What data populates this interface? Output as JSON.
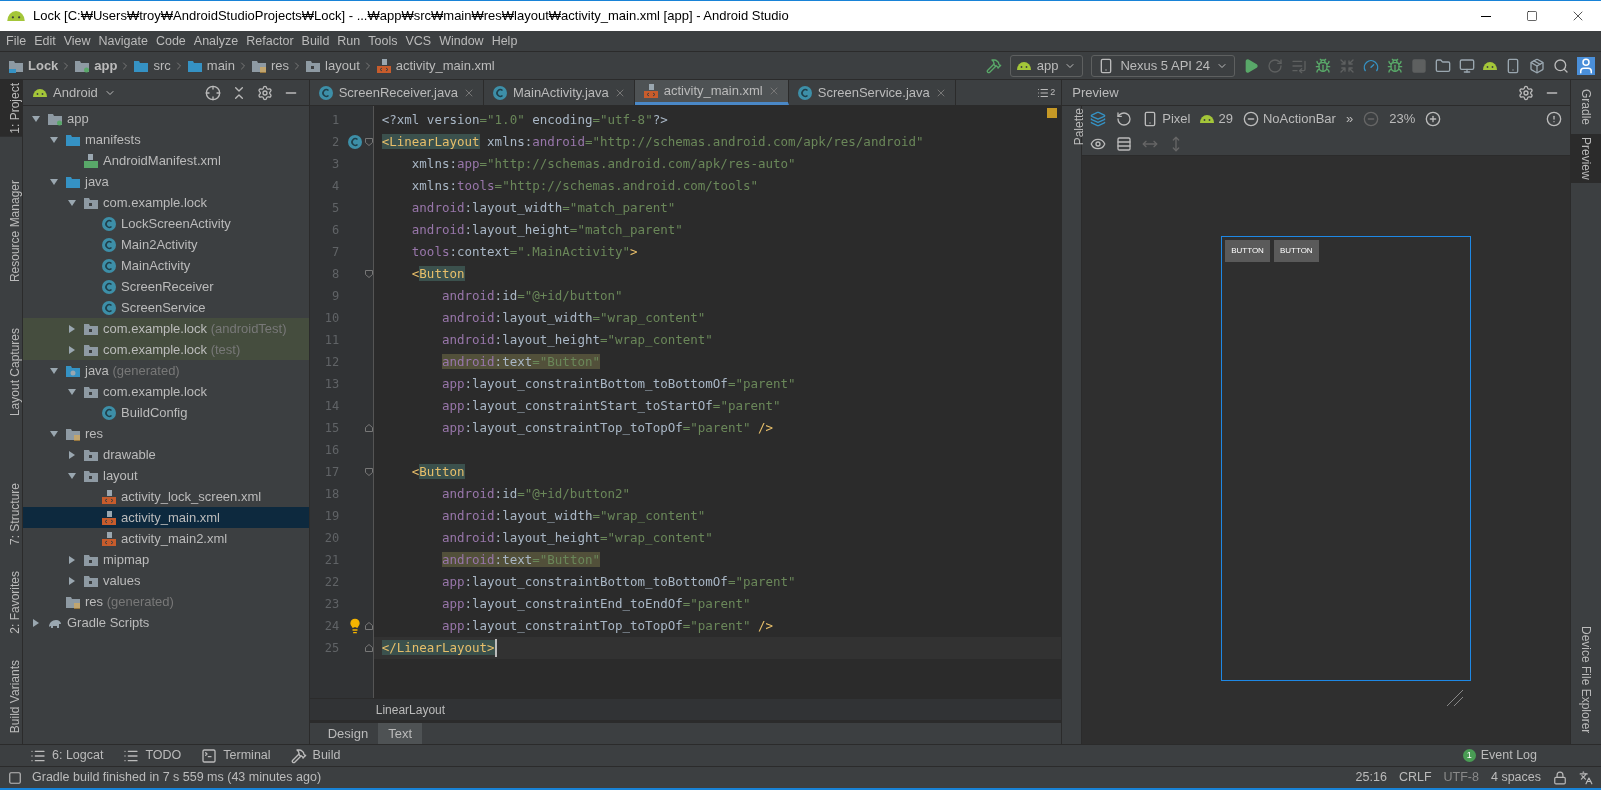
{
  "window": {
    "title": "Lock [C:₩Users₩troy₩AndroidStudioProjects₩Lock] - ...₩app₩src₩main₩res₩layout₩activity_main.xml [app] - Android Studio"
  },
  "menu": [
    "File",
    "Edit",
    "View",
    "Navigate",
    "Code",
    "Analyze",
    "Refactor",
    "Build",
    "Run",
    "Tools",
    "VCS",
    "Window",
    "Help"
  ],
  "breadcrumbs": [
    {
      "label": "Lock",
      "kind": "project"
    },
    {
      "label": "app",
      "kind": "module"
    },
    {
      "label": "src",
      "kind": "folder"
    },
    {
      "label": "main",
      "kind": "folder"
    },
    {
      "label": "res",
      "kind": "res"
    },
    {
      "label": "layout",
      "kind": "package"
    },
    {
      "label": "activity_main.xml",
      "kind": "xml"
    }
  ],
  "toolbar": {
    "run_config": "app",
    "device": "Nexus 5 API 24"
  },
  "left_stripe": [
    {
      "label": "1: Project",
      "selected": true
    },
    {
      "label": "Resource Manager",
      "selected": false
    },
    {
      "label": "Layout Captures",
      "selected": false
    },
    {
      "label": "7: Structure",
      "selected": false
    },
    {
      "label": "2: Favorites",
      "selected": false
    },
    {
      "label": "Build Variants",
      "selected": false
    }
  ],
  "right_stripe": [
    {
      "label": "Gradle",
      "selected": false
    },
    {
      "label": "Preview",
      "selected": true
    },
    {
      "label": "Device File Explorer",
      "selected": false
    }
  ],
  "project_panel": {
    "view": "Android",
    "tree": [
      {
        "label": "app",
        "kind": "module",
        "expanded": true,
        "selected": false,
        "highlighted": false,
        "children": [
          {
            "label": "manifests",
            "kind": "folder",
            "expanded": true,
            "selected": false,
            "highlighted": false,
            "children": [
              {
                "label": "AndroidManifest.xml",
                "kind": "manifest",
                "selected": false,
                "highlighted": false
              }
            ]
          },
          {
            "label": "java",
            "kind": "folder",
            "expanded": true,
            "selected": false,
            "highlighted": false,
            "children": [
              {
                "label": "com.example.lock",
                "kind": "package",
                "expanded": true,
                "selected": false,
                "highlighted": false,
                "children": [
                  {
                    "label": "LockScreenActivity",
                    "kind": "class",
                    "selected": false,
                    "highlighted": false
                  },
                  {
                    "label": "Main2Activity",
                    "kind": "class",
                    "selected": false,
                    "highlighted": false
                  },
                  {
                    "label": "MainActivity",
                    "kind": "class",
                    "selected": false,
                    "highlighted": false
                  },
                  {
                    "label": "ScreenReceiver",
                    "kind": "class",
                    "selected": false,
                    "highlighted": false
                  },
                  {
                    "label": "ScreenService",
                    "kind": "class",
                    "selected": false,
                    "highlighted": false
                  }
                ]
              },
              {
                "label": "com.example.lock",
                "note": "(androidTest)",
                "kind": "package",
                "expanded": false,
                "selected": false,
                "highlighted": true
              },
              {
                "label": "com.example.lock",
                "note": "(test)",
                "kind": "package",
                "expanded": false,
                "selected": false,
                "highlighted": true
              }
            ]
          },
          {
            "label": "java",
            "note": "(generated)",
            "kind": "generated",
            "expanded": true,
            "selected": false,
            "highlighted": false,
            "children": [
              {
                "label": "com.example.lock",
                "kind": "package",
                "expanded": true,
                "selected": false,
                "highlighted": false,
                "children": [
                  {
                    "label": "BuildConfig",
                    "kind": "class",
                    "selected": false,
                    "highlighted": false
                  }
                ]
              }
            ]
          },
          {
            "label": "res",
            "kind": "res",
            "expanded": true,
            "selected": false,
            "highlighted": false,
            "children": [
              {
                "label": "drawable",
                "kind": "package",
                "expanded": false,
                "selected": false,
                "highlighted": false
              },
              {
                "label": "layout",
                "kind": "package",
                "expanded": true,
                "selected": false,
                "highlighted": false,
                "children": [
                  {
                    "label": "activity_lock_screen.xml",
                    "kind": "xml",
                    "selected": false,
                    "highlighted": false
                  },
                  {
                    "label": "activity_main.xml",
                    "kind": "xml",
                    "selected": true,
                    "highlighted": false
                  },
                  {
                    "label": "activity_main2.xml",
                    "kind": "xml",
                    "selected": false,
                    "highlighted": false
                  }
                ]
              },
              {
                "label": "mipmap",
                "kind": "package",
                "expanded": false,
                "selected": false,
                "highlighted": false
              },
              {
                "label": "values",
                "kind": "package",
                "expanded": false,
                "selected": false,
                "highlighted": false
              }
            ]
          },
          {
            "label": "res",
            "note": "(generated)",
            "kind": "res",
            "selected": false,
            "highlighted": false
          }
        ]
      },
      {
        "label": "Gradle Scripts",
        "kind": "gradle",
        "expanded": false,
        "selected": false,
        "highlighted": false
      }
    ]
  },
  "editor": {
    "tabs": [
      {
        "label": "ScreenReceiver.java",
        "kind": "class",
        "selected": false
      },
      {
        "label": "MainActivity.java",
        "kind": "class",
        "selected": false
      },
      {
        "label": "activity_main.xml",
        "kind": "xml",
        "selected": true
      },
      {
        "label": "ScreenService.java",
        "kind": "class",
        "selected": false
      }
    ],
    "hidden_tabs": "2",
    "lines": [
      {
        "number": "1",
        "current": false,
        "tokens": [
          {
            "kind": "plain",
            "text": "<?xml version"
          },
          {
            "kind": "str",
            "text": "=\"1.0\""
          },
          {
            "kind": "plain",
            "text": " encoding"
          },
          {
            "kind": "str",
            "text": "=\"utf-8\""
          },
          {
            "kind": "plain",
            "text": "?>"
          }
        ]
      },
      {
        "number": "2",
        "current": false,
        "class_marker": true,
        "fold_start": true,
        "tokens": [
          {
            "kind": "tag",
            "text": "<LinearLayout",
            "marked": true
          },
          {
            "kind": "plain",
            "text": " xmlns:"
          },
          {
            "kind": "ns",
            "text": "android"
          },
          {
            "kind": "str",
            "text": "=\"http://schemas.android.com/apk/res/android\""
          }
        ]
      },
      {
        "number": "3",
        "current": false,
        "tokens": [
          {
            "kind": "plain",
            "text": "    xmlns:"
          },
          {
            "kind": "ns",
            "text": "app"
          },
          {
            "kind": "str",
            "text": "=\"http://schemas.android.com/apk/res-auto\""
          }
        ]
      },
      {
        "number": "4",
        "current": false,
        "tokens": [
          {
            "kind": "plain",
            "text": "    xmlns:"
          },
          {
            "kind": "ns",
            "text": "tools"
          },
          {
            "kind": "str",
            "text": "=\"http://schemas.android.com/tools\""
          }
        ]
      },
      {
        "number": "5",
        "current": false,
        "tokens": [
          {
            "kind": "ns",
            "text": "    android"
          },
          {
            "kind": "plain",
            "text": ":layout_width"
          },
          {
            "kind": "str",
            "text": "=\"match_parent\""
          }
        ]
      },
      {
        "number": "6",
        "current": false,
        "tokens": [
          {
            "kind": "ns",
            "text": "    android"
          },
          {
            "kind": "plain",
            "text": ":layout_height"
          },
          {
            "kind": "str",
            "text": "=\"match_parent\""
          }
        ]
      },
      {
        "number": "7",
        "current": false,
        "tokens": [
          {
            "kind": "ns",
            "text": "    tools"
          },
          {
            "kind": "plain",
            "text": ":context"
          },
          {
            "kind": "str",
            "text": "=\".MainActivity\""
          },
          {
            "kind": "tag",
            "text": ">"
          }
        ]
      },
      {
        "number": "8",
        "current": false,
        "fold_start": true,
        "tokens": [
          {
            "kind": "tag",
            "text": "    <"
          },
          {
            "kind": "tag",
            "text": "Button",
            "marked": true
          }
        ]
      },
      {
        "number": "9",
        "current": false,
        "tokens": [
          {
            "kind": "ns",
            "text": "        android"
          },
          {
            "kind": "plain",
            "text": ":id"
          },
          {
            "kind": "str",
            "text": "=\"@+id/button\""
          }
        ]
      },
      {
        "number": "10",
        "current": false,
        "tokens": [
          {
            "kind": "ns",
            "text": "        android"
          },
          {
            "kind": "plain",
            "text": ":layout_width"
          },
          {
            "kind": "str",
            "text": "=\"wrap_content\""
          }
        ]
      },
      {
        "number": "11",
        "current": false,
        "tokens": [
          {
            "kind": "ns",
            "text": "        android"
          },
          {
            "kind": "plain",
            "text": ":layout_height"
          },
          {
            "kind": "str",
            "text": "=\"wrap_content\""
          }
        ]
      },
      {
        "number": "12",
        "current": false,
        "tokens": [
          {
            "kind": "ns",
            "text": "        android",
            "marked": true
          },
          {
            "kind": "plain",
            "text": ":text",
            "marked": true
          },
          {
            "kind": "str",
            "text": "=\"Button\"",
            "marked": true
          }
        ]
      },
      {
        "number": "13",
        "current": false,
        "tokens": [
          {
            "kind": "ns",
            "text": "        app"
          },
          {
            "kind": "plain",
            "text": ":layout_constraintBottom_toBottomOf"
          },
          {
            "kind": "str",
            "text": "=\"parent\""
          }
        ]
      },
      {
        "number": "14",
        "current": false,
        "tokens": [
          {
            "kind": "ns",
            "text": "        app"
          },
          {
            "kind": "plain",
            "text": ":layout_constraintStart_toStartOf"
          },
          {
            "kind": "str",
            "text": "=\"parent\""
          }
        ]
      },
      {
        "number": "15",
        "current": false,
        "fold_end": true,
        "tokens": [
          {
            "kind": "ns",
            "text": "        app"
          },
          {
            "kind": "plain",
            "text": ":layout_constraintTop_toTopOf"
          },
          {
            "kind": "str",
            "text": "=\"parent\""
          },
          {
            "kind": "tag",
            "text": " />"
          }
        ]
      },
      {
        "number": "16",
        "current": false
      },
      {
        "number": "17",
        "current": false,
        "fold_start": true,
        "tokens": [
          {
            "kind": "tag",
            "text": "    <"
          },
          {
            "kind": "tag",
            "text": "Button",
            "marked": true
          }
        ]
      },
      {
        "number": "18",
        "current": false,
        "tokens": [
          {
            "kind": "ns",
            "text": "        android"
          },
          {
            "kind": "plain",
            "text": ":id"
          },
          {
            "kind": "str",
            "text": "=\"@+id/button2\""
          }
        ]
      },
      {
        "number": "19",
        "current": false,
        "tokens": [
          {
            "kind": "ns",
            "text": "        android"
          },
          {
            "kind": "plain",
            "text": ":layout_width"
          },
          {
            "kind": "str",
            "text": "=\"wrap_content\""
          }
        ]
      },
      {
        "number": "20",
        "current": false,
        "tokens": [
          {
            "kind": "ns",
            "text": "        android"
          },
          {
            "kind": "plain",
            "text": ":layout_height"
          },
          {
            "kind": "str",
            "text": "=\"wrap_content\""
          }
        ]
      },
      {
        "number": "21",
        "current": false,
        "tokens": [
          {
            "kind": "ns",
            "text": "        android",
            "marked": true
          },
          {
            "kind": "plain",
            "text": ":text",
            "marked": true
          },
          {
            "kind": "str",
            "text": "=\"Button\"",
            "marked": true
          }
        ]
      },
      {
        "number": "22",
        "current": false,
        "tokens": [
          {
            "kind": "ns",
            "text": "        app"
          },
          {
            "kind": "plain",
            "text": ":layout_constraintBottom_toBottomOf"
          },
          {
            "kind": "str",
            "text": "=\"parent\""
          }
        ]
      },
      {
        "number": "23",
        "current": false,
        "tokens": [
          {
            "kind": "ns",
            "text": "        app"
          },
          {
            "kind": "plain",
            "text": ":layout_constraintEnd_toEndOf"
          },
          {
            "kind": "str",
            "text": "=\"parent\""
          }
        ]
      },
      {
        "number": "24",
        "current": false,
        "intention_bulb": true,
        "fold_end": true,
        "tokens": [
          {
            "kind": "ns",
            "text": "        app"
          },
          {
            "kind": "plain",
            "text": ":layout_constraintTop_toTopOf"
          },
          {
            "kind": "str",
            "text": "=\"parent\""
          },
          {
            "kind": "tag",
            "text": " />"
          }
        ]
      },
      {
        "number": "25",
        "current": true,
        "fold_end": true,
        "tokens": [
          {
            "kind": "tag",
            "text": "</LinearLayout>",
            "marked": true
          }
        ]
      }
    ],
    "breadcrumb": "LinearLayout",
    "mode_tabs": [
      {
        "label": "Design",
        "selected": false
      },
      {
        "label": "Text",
        "selected": true
      }
    ]
  },
  "preview": {
    "title": "Preview",
    "palette": "Palette",
    "device": "Pixel",
    "api": "29",
    "theme": "NoActionBar",
    "more": "»",
    "zoom": "23%",
    "buttons": [
      "BUTTON",
      "BUTTON"
    ]
  },
  "tool_windows": [
    {
      "label": "6: Logcat",
      "kind": "logcat"
    },
    {
      "label": "TODO",
      "kind": "todo"
    },
    {
      "label": "Terminal",
      "kind": "terminal"
    },
    {
      "label": "Build",
      "kind": "build"
    }
  ],
  "event_log": {
    "label": "Event Log",
    "count": "1"
  },
  "status_bar": {
    "message": "Gradle build finished in 7 s 559 ms (43 minutes ago)",
    "position": "25:16",
    "line_separator": "CRLF",
    "encoding": "UTF-8",
    "indent": "4 spaces"
  }
}
